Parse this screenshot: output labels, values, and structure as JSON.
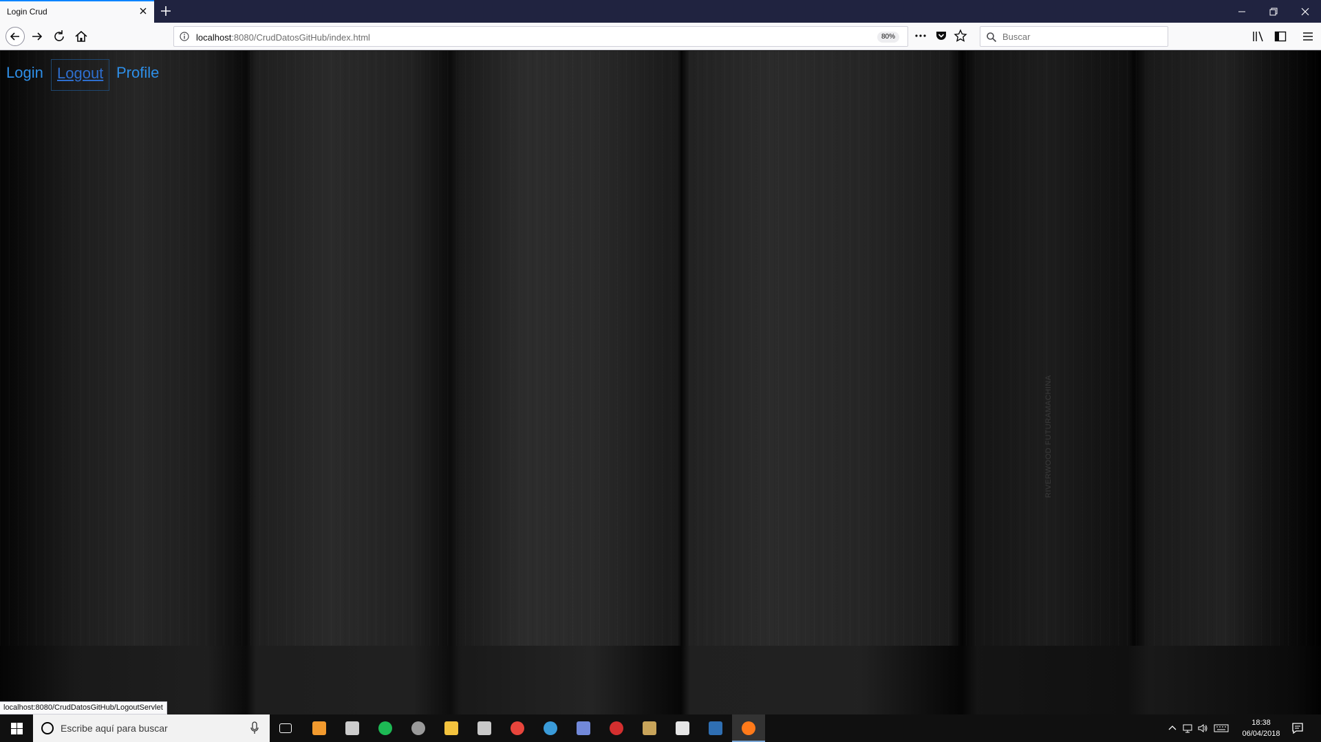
{
  "browser": {
    "tab_title": "Login Crud",
    "url_host": "localhost",
    "url_rest": ":8080/CrudDatosGitHub/index.html",
    "zoom": "80%",
    "search_placeholder": "Buscar",
    "status_url": "localhost:8080/CrudDatosGitHub/LogoutServlet"
  },
  "site": {
    "nav": [
      {
        "label": "Login"
      },
      {
        "label": "Logout"
      },
      {
        "label": "Profile"
      }
    ],
    "watermark": "RIVERWOOD FUTURAMACHINA"
  },
  "taskbar": {
    "search_placeholder": "Escribe aquí para buscar",
    "time": "18:38",
    "date": "06/04/2018",
    "apps": [
      {
        "name": "task-view-icon",
        "color": "#ffffff"
      },
      {
        "name": "sublime-text-icon",
        "color": "#f29a2e"
      },
      {
        "name": "terminal-icon",
        "color": "#cccccc"
      },
      {
        "name": "spotify-icon",
        "color": "#1db954"
      },
      {
        "name": "obs-icon",
        "color": "#9a9a9a"
      },
      {
        "name": "file-explorer-icon",
        "color": "#f3c33e"
      },
      {
        "name": "printer-icon",
        "color": "#c9c9c9"
      },
      {
        "name": "chrome-icon",
        "color": "#e8453c"
      },
      {
        "name": "ccleaner-icon",
        "color": "#3a9bd9"
      },
      {
        "name": "discord-icon",
        "color": "#7289da"
      },
      {
        "name": "game-launcher-icon",
        "color": "#d42f2f"
      },
      {
        "name": "league-of-legends-icon",
        "color": "#c8a45a"
      },
      {
        "name": "epic-games-icon",
        "color": "#e6e6e6"
      },
      {
        "name": "virtualbox-icon",
        "color": "#2f6fb3"
      },
      {
        "name": "firefox-icon",
        "color": "#ff7a1a"
      }
    ]
  }
}
